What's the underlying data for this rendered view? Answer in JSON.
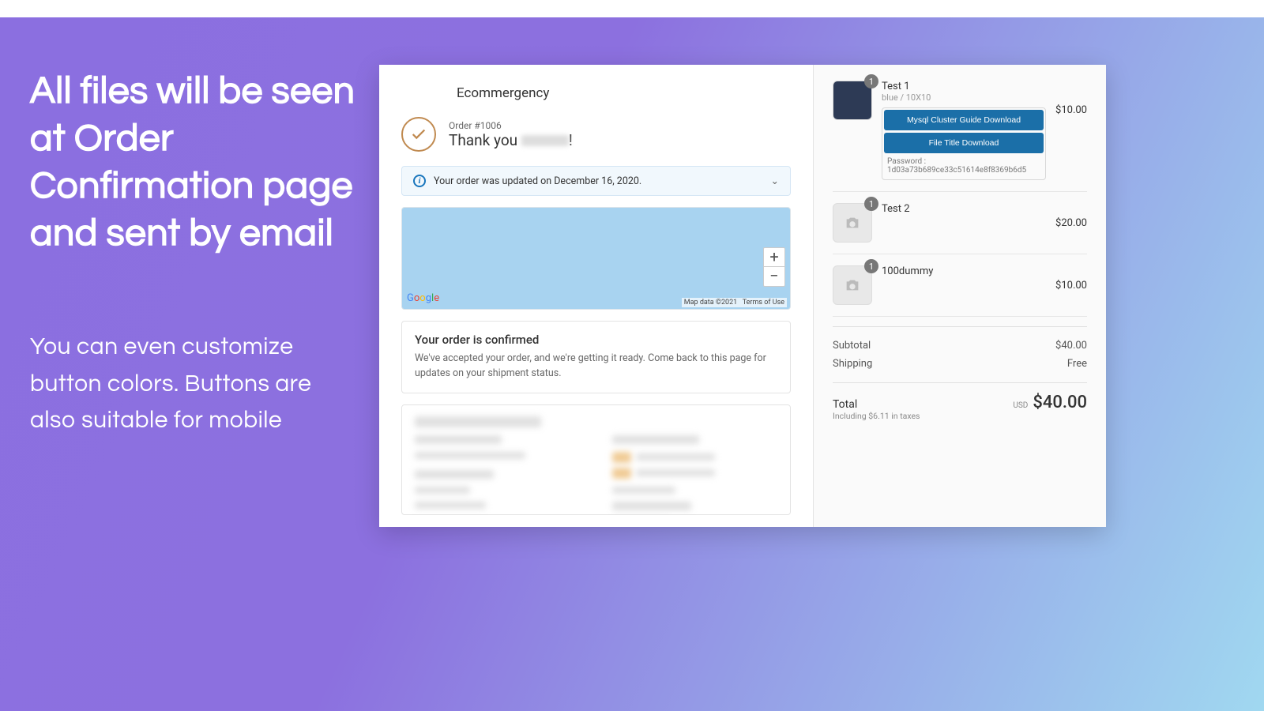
{
  "promo": {
    "title": "All files will be seen at Order Confirmation page and sent by email",
    "subtitle": "You can even customize button colors. Buttons are also suitable for mobile"
  },
  "store": {
    "name": "Ecommergency"
  },
  "order": {
    "number": "Order #1006",
    "thank_prefix": "Thank you ",
    "thank_suffix": "!",
    "update_msg": "Your order was updated on December 16, 2020.",
    "confirmed_heading": "Your order is confirmed",
    "confirmed_body": "We've accepted your order, and we're getting it ready. Come back to this page for updates on your shipment status."
  },
  "map": {
    "brand": [
      "G",
      "o",
      "o",
      "g",
      "l",
      "e"
    ],
    "attribution": "Map data ©2021",
    "terms": "Terms of Use",
    "zoom_in": "+",
    "zoom_out": "−"
  },
  "cart": {
    "items": [
      {
        "name": "Test 1",
        "variant": "blue / 10X10",
        "qty": "1",
        "price": "$10.00",
        "buttons": [
          "Mysql Cluster Guide Download",
          "File Title Download"
        ],
        "password_label": "Password :",
        "password_value": "1d03a73b689ce33c51614e8f8369b6d5"
      },
      {
        "name": "Test 2",
        "qty": "1",
        "price": "$20.00"
      },
      {
        "name": "100dummy",
        "qty": "1",
        "price": "$10.00"
      }
    ],
    "subtotal_label": "Subtotal",
    "subtotal": "$40.00",
    "shipping_label": "Shipping",
    "shipping": "Free",
    "total_label": "Total",
    "tax_note": "Including $6.11 in taxes",
    "currency": "USD",
    "total": "$40.00"
  }
}
